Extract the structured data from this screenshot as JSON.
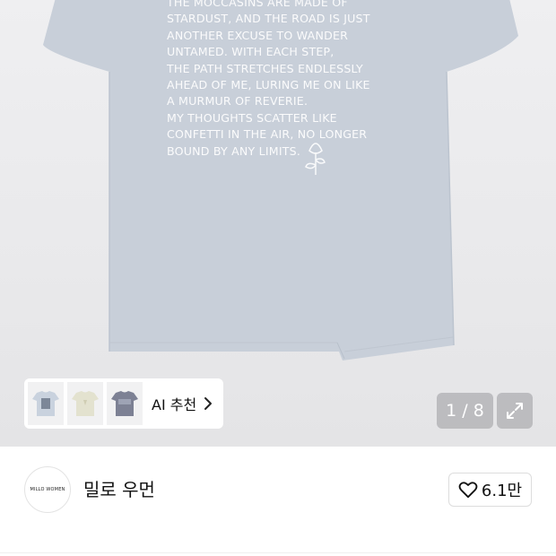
{
  "product_image": {
    "print_lines": [
      "THE MOCCASINS ARE MADE OF",
      "STARDUST, AND THE ROAD IS JUST",
      "ANOTHER EXCUSE TO WANDER",
      "UNTAMED. WITH EACH STEP,",
      "THE PATH STRETCHES ENDLESSLY",
      "AHEAD OF ME, LURING ME ON LIKE",
      "A MURMUR OF REVERIE.",
      "MY THOUGHTS SCATTER LIKE",
      "CONFETTI IN THE AIR, NO LONGER",
      "BOUND BY ANY LIMITS."
    ],
    "shirt_color": "#c9d0da"
  },
  "ai_recommend": {
    "label": "AI 추천",
    "thumbnails": [
      "thumb-light-blue-tee",
      "thumb-beige-tee",
      "thumb-grey-tee"
    ]
  },
  "gallery": {
    "counter": "1 / 8"
  },
  "brand": {
    "logo_text": "MILLO WOMEN",
    "name": "밀로 우먼"
  },
  "like": {
    "count": "6.1만"
  }
}
